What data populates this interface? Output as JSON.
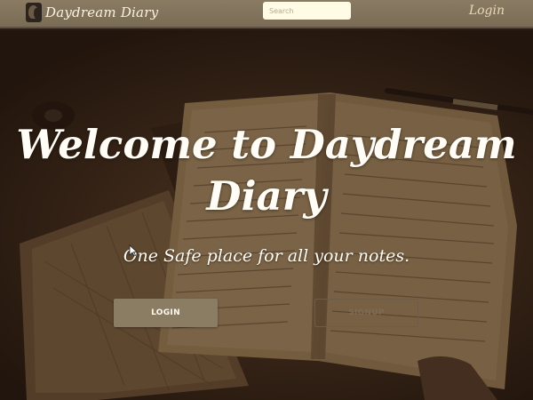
{
  "navbar": {
    "brand": "Daydream Diary",
    "search_placeholder": "Search",
    "login_label": "Login"
  },
  "hero": {
    "title": "Welcome to Daydream Diary",
    "subtitle": "One Safe place for all your notes.",
    "login_button": "LOGIN",
    "signup_button": "SIGNUP"
  },
  "colors": {
    "navbar": "#7f7059",
    "brand_text": "#fbf3df",
    "login_button_bg": "#8b7c64",
    "hero_text": "#fffdf6"
  },
  "icons": {
    "logo": "brand-logo-icon",
    "cursor": "mouse-pointer-icon"
  }
}
